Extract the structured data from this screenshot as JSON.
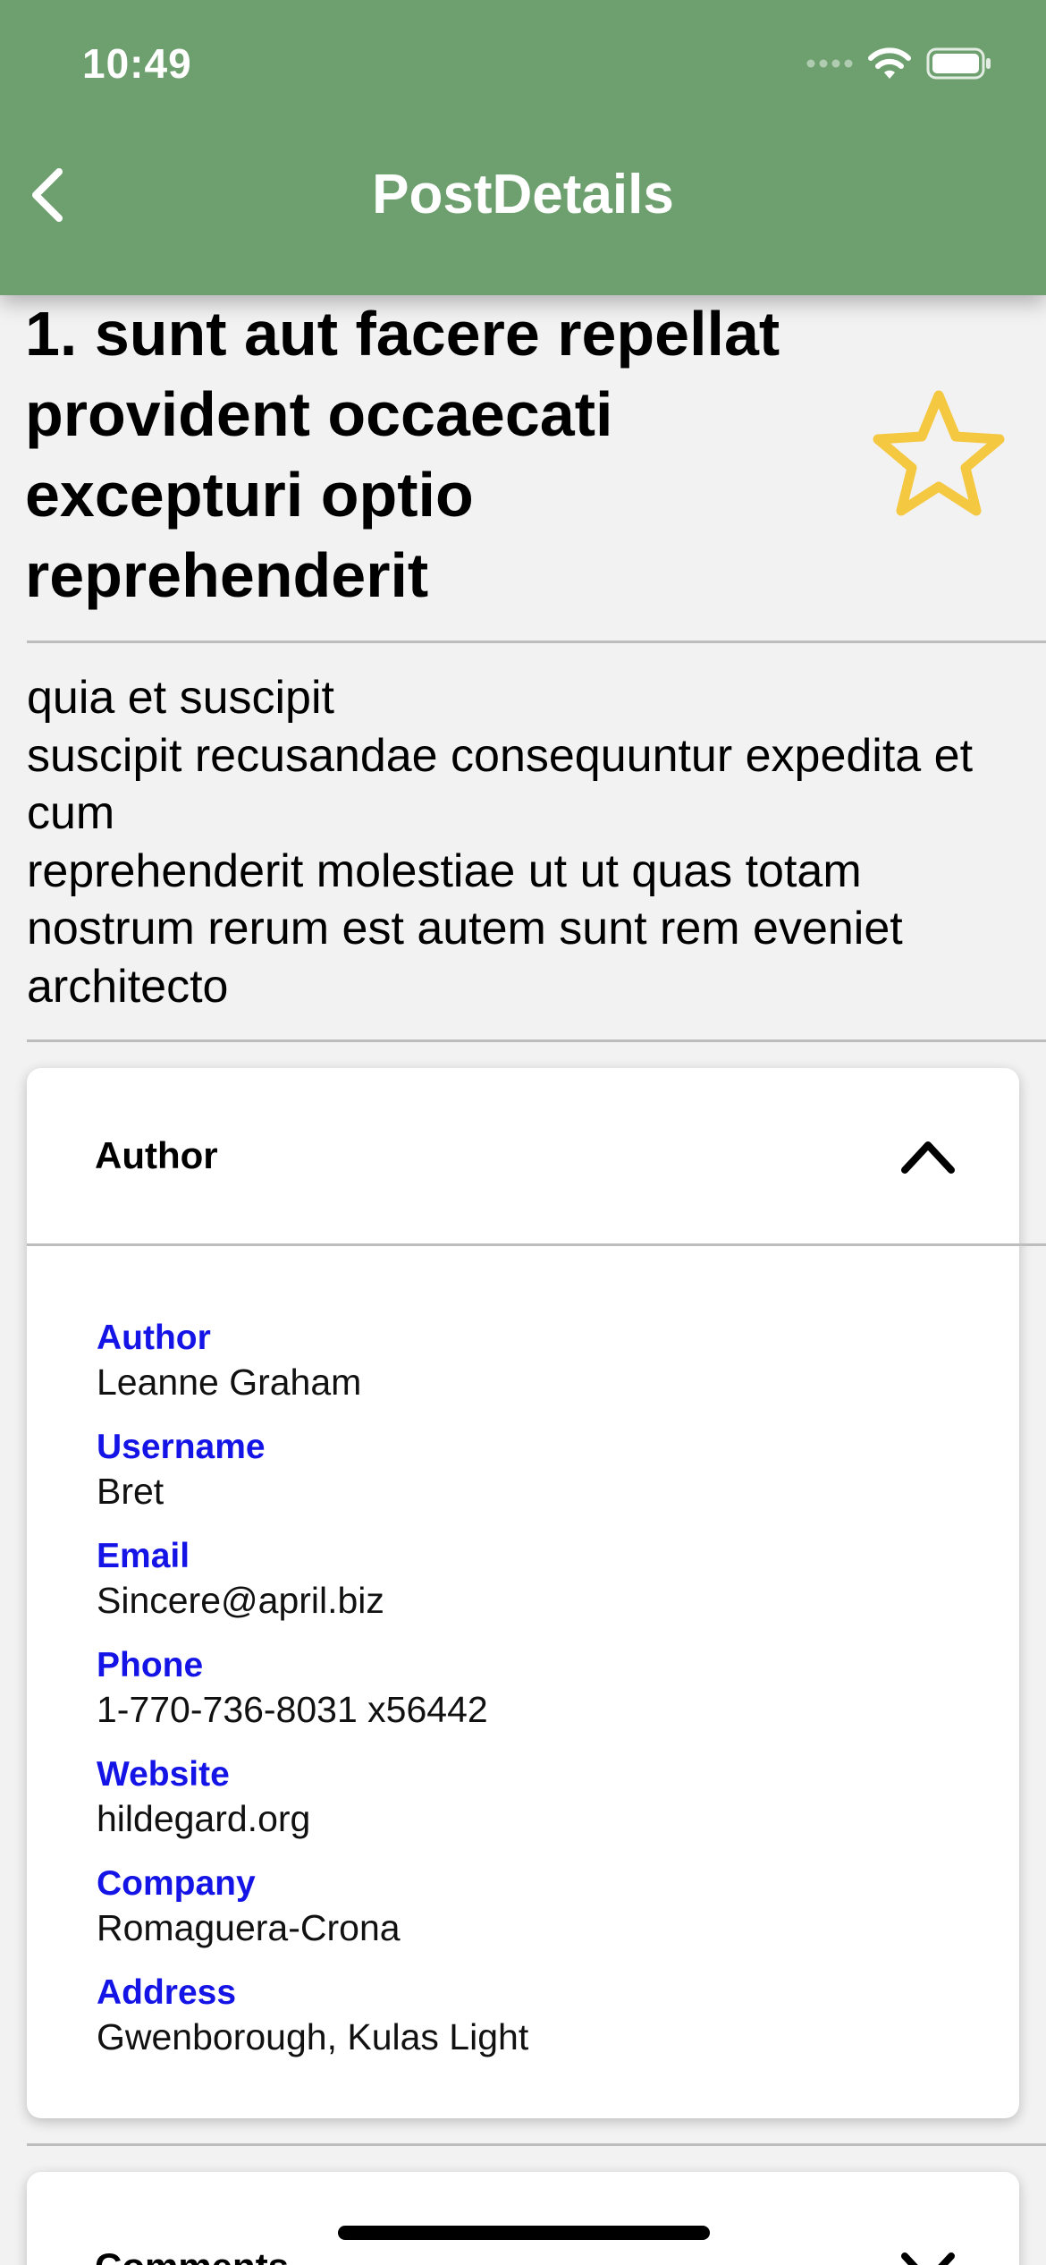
{
  "status_bar": {
    "time": "10:49"
  },
  "nav": {
    "title": "PostDetails"
  },
  "post": {
    "title": "1. sunt aut facere repellat provident occaecati excepturi optio reprehenderit",
    "body_lines": [
      "quia et suscipit",
      "suscipit recusandae consequuntur expedita et cum",
      "reprehenderit molestiae ut ut quas totam",
      "nostrum rerum est autem sunt rem eveniet architecto"
    ]
  },
  "author_section": {
    "title": "Author",
    "fields": [
      {
        "label": "Author",
        "value": "Leanne Graham"
      },
      {
        "label": "Username",
        "value": "Bret"
      },
      {
        "label": "Email",
        "value": "Sincere@april.biz"
      },
      {
        "label": "Phone",
        "value": "1-770-736-8031 x56442"
      },
      {
        "label": "Website",
        "value": "hildegard.org"
      },
      {
        "label": "Company",
        "value": "Romaguera-Crona"
      },
      {
        "label": "Address",
        "value": "Gwenborough, Kulas Light"
      }
    ]
  },
  "comments_section": {
    "title": "Comments"
  },
  "colors": {
    "header": "#6ea06f",
    "field_label": "#1414e6",
    "star": "#f5c842"
  },
  "icons": {
    "back": "chevron-left-icon",
    "favorite": "star-outline-icon",
    "expand": "chevron-up-icon",
    "collapse": "chevron-down-icon"
  }
}
